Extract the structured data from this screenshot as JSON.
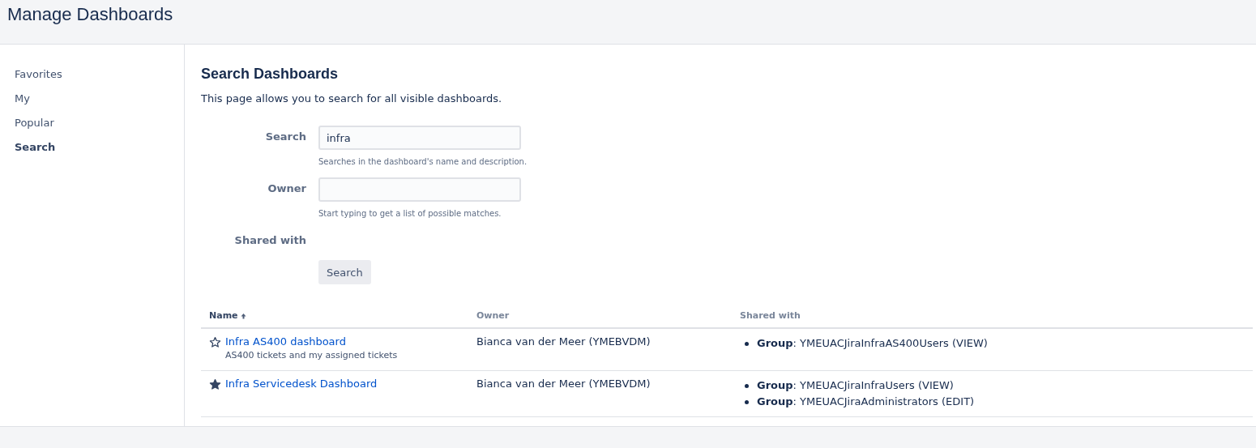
{
  "page_title": "Manage Dashboards",
  "sidebar": {
    "items": [
      {
        "label": "Favorites",
        "selected": false
      },
      {
        "label": "My",
        "selected": false
      },
      {
        "label": "Popular",
        "selected": false
      },
      {
        "label": "Search",
        "selected": true
      }
    ]
  },
  "heading": "Search Dashboards",
  "intro": "This page allows you to search for all visible dashboards.",
  "form": {
    "search": {
      "label": "Search",
      "value": "infra",
      "help": "Searches in the dashboard's name and description."
    },
    "owner": {
      "label": "Owner",
      "help": "Start typing to get a list of possible matches."
    },
    "shared_with": {
      "label": "Shared with"
    },
    "button": "Search"
  },
  "table": {
    "columns": [
      {
        "label": "Name",
        "sorted": true
      },
      {
        "label": "Owner",
        "sorted": false
      },
      {
        "label": "Shared with",
        "sorted": false
      }
    ],
    "rows": [
      {
        "favorite": false,
        "name": "Infra AS400 dashboard",
        "description": "AS400 tickets and my assigned tickets",
        "owner": "Bianca van der Meer (YMEBVDM)",
        "shares": [
          "**Group**: YMEUACJiraInfraAS400Users (VIEW)"
        ]
      },
      {
        "favorite": true,
        "name": "Infra Servicedesk Dashboard",
        "owner": "Bianca van der Meer (YMEBVDM)",
        "shares": [
          "**Group**: YMEUACJiraInfraUsers (VIEW)",
          "**Group**: YMEUACJiraAdministrators (EDIT)"
        ]
      }
    ]
  }
}
